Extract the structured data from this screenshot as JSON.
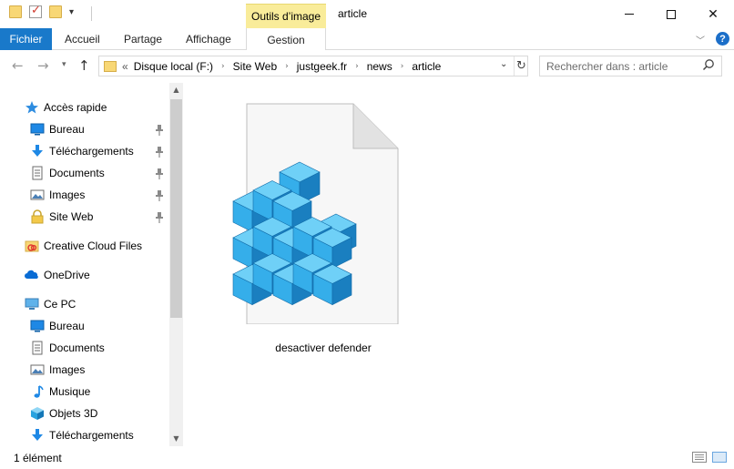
{
  "window": {
    "title": "article",
    "context_tab": "Outils d’image"
  },
  "ribbon": {
    "tabs": [
      {
        "label": "Fichier",
        "active": true
      },
      {
        "label": "Accueil"
      },
      {
        "label": "Partage"
      },
      {
        "label": "Affichage"
      },
      {
        "label": "Gestion"
      }
    ]
  },
  "address": {
    "overflow": "«",
    "crumbs": [
      "Disque local (F:)",
      "Site Web",
      "justgeek.fr",
      "news",
      "article"
    ]
  },
  "search": {
    "placeholder": "Rechercher dans : article"
  },
  "nav_pane": {
    "quick_access": {
      "label": "Accès rapide",
      "items": [
        {
          "label": "Bureau",
          "icon": "desktop-icon",
          "pinned": true
        },
        {
          "label": "Téléchargements",
          "icon": "download-icon",
          "pinned": true
        },
        {
          "label": "Documents",
          "icon": "documents-icon",
          "pinned": true
        },
        {
          "label": "Images",
          "icon": "images-icon",
          "pinned": true
        },
        {
          "label": "Site Web",
          "icon": "locked-folder-icon",
          "pinned": true
        }
      ]
    },
    "creative_cloud": {
      "label": "Creative Cloud Files"
    },
    "onedrive": {
      "label": "OneDrive"
    },
    "this_pc": {
      "label": "Ce PC",
      "items": [
        {
          "label": "Bureau",
          "icon": "desktop-icon"
        },
        {
          "label": "Documents",
          "icon": "documents-icon"
        },
        {
          "label": "Images",
          "icon": "images-icon"
        },
        {
          "label": "Musique",
          "icon": "music-icon"
        },
        {
          "label": "Objets 3D",
          "icon": "3d-objects-icon"
        },
        {
          "label": "Téléchargements",
          "icon": "download-icon"
        }
      ]
    }
  },
  "content": {
    "files": [
      {
        "name": "desactiver defender",
        "icon": "registry-file-icon"
      }
    ]
  },
  "status": {
    "count": "1 élément"
  },
  "colors": {
    "accent": "#1979ca",
    "context_tab": "#f9ec9a",
    "folder": "#f8d775",
    "cube": "#3aa9e8"
  }
}
